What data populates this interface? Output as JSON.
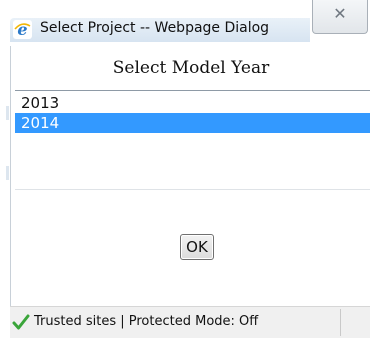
{
  "window": {
    "title": "Select Project -- Webpage Dialog",
    "close_glyph": "✕"
  },
  "dialog": {
    "heading": "Select Model Year",
    "list": {
      "items": [
        {
          "label": "2013",
          "selected": false
        },
        {
          "label": "2014",
          "selected": true
        }
      ]
    },
    "ok_label": "OK"
  },
  "status": {
    "text": "Trusted sites | Protected Mode: Off",
    "icon": "checkmark-icon"
  },
  "colors": {
    "selection": "#3399ff",
    "check": "#3aa53a",
    "ie_icon": "#2b79c9"
  }
}
